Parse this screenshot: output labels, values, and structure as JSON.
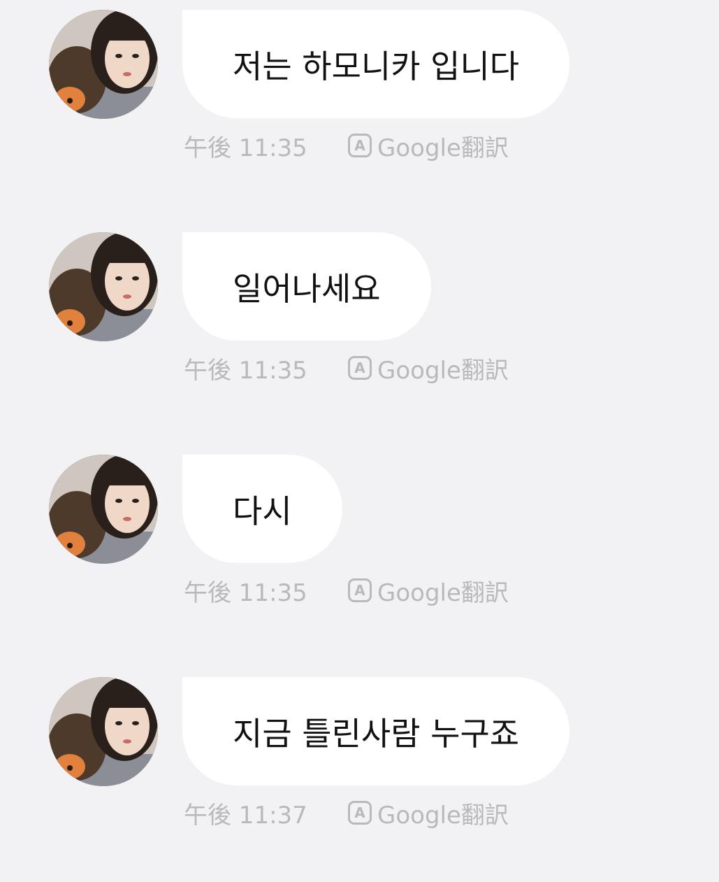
{
  "messages": [
    {
      "text": "저는 하모니카 입니다",
      "time": "午後 11:35",
      "translate_label": "Google翻訳",
      "translate_icon": "A"
    },
    {
      "text": "일어나세요",
      "time": "午後 11:35",
      "translate_label": "Google翻訳",
      "translate_icon": "A"
    },
    {
      "text": "다시",
      "time": "午後 11:35",
      "translate_label": "Google翻訳",
      "translate_icon": "A"
    },
    {
      "text": "지금 틀린사람 누구죠",
      "time": "午後 11:37",
      "translate_label": "Google翻訳",
      "translate_icon": "A"
    }
  ],
  "colors": {
    "background": "#f2f2f4",
    "bubble": "#ffffff",
    "meta_text": "#b9b9bd",
    "message_text": "#111111"
  }
}
